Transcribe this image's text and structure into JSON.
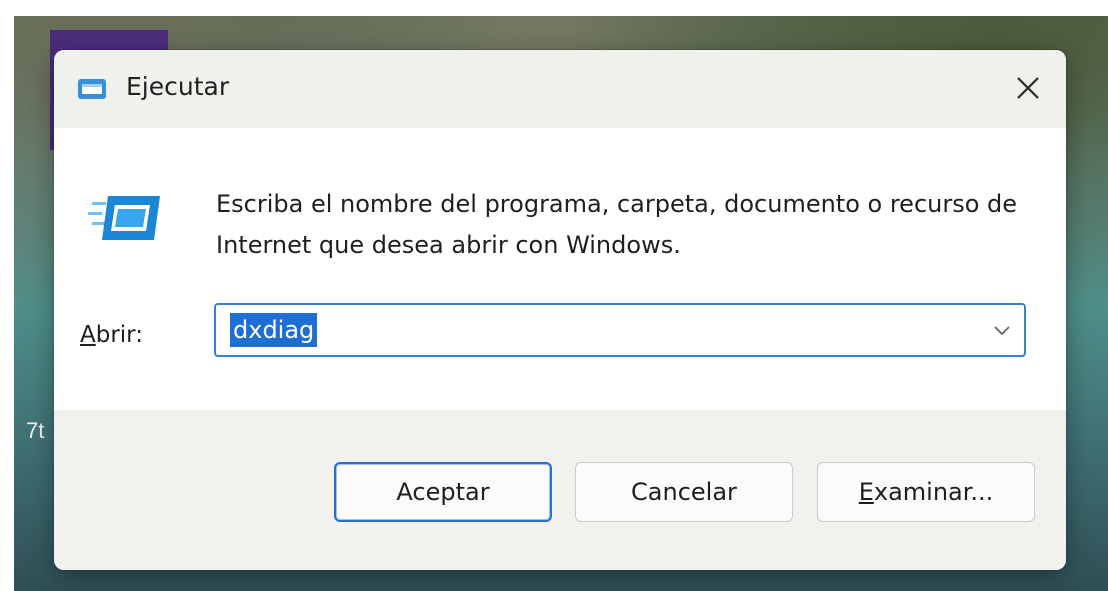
{
  "desktop": {
    "partial_text": "7t",
    "tile_color": "#4b2d7a"
  },
  "dialog": {
    "title": "Ejecutar",
    "title_icon": "run-icon",
    "close_icon": "close-icon",
    "description": "Escriba el nombre del programa, carpeta, documento o recurso de Internet que desea abrir con Windows.",
    "open_label_accel": "A",
    "open_label_rest": "brir:",
    "open_value": "dxdiag",
    "dropdown_icon": "chevron-down-icon",
    "buttons": {
      "ok_label": "Aceptar",
      "cancel_label": "Cancelar",
      "browse_accel": "E",
      "browse_rest": "xaminar..."
    },
    "accent_color": "#1e6fd1"
  }
}
